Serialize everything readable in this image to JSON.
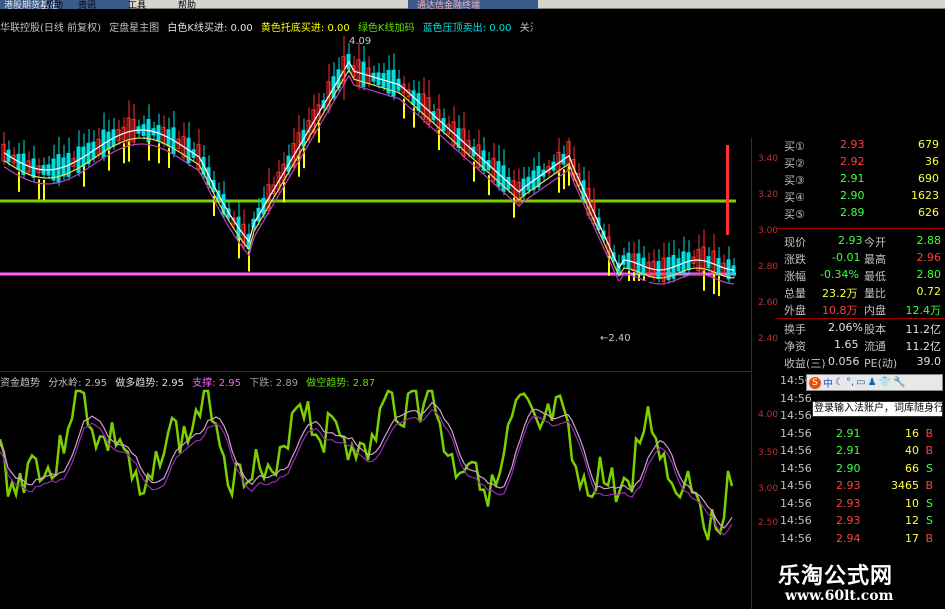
{
  "menu": {
    "tab_left": "港股期货基金",
    "items": [
      "帮助",
      "资讯",
      "工具",
      "帮助"
    ],
    "tab_right": "通达信金融终端"
  },
  "main_chart": {
    "stock_name": "华联控股(日线 前复权)",
    "indicator": "定盘星主图",
    "white_k": "白色K线买进: 0.00",
    "yellow": "黄色托底买进: 0.00",
    "green": "绿色K线加码",
    "cyan": "蓝色压顶卖出: 0.00",
    "attention": "关注信",
    "high_label": "4.09",
    "low_label": "←2.40",
    "y_ticks": [
      "3.40",
      "3.20",
      "3.00",
      "2.80",
      "2.60",
      "2.40"
    ]
  },
  "sub_chart": {
    "name": "资金趋势",
    "water": "分水岭: 2.95",
    "long": "做多趋势: 2.95",
    "support": "支撑: 2.95",
    "down": "下跌: 2.89",
    "short": "做空趋势: 2.87",
    "y_ticks": [
      "4.00",
      "3.50",
      "3.00",
      "2.50"
    ]
  },
  "colors": {
    "green_line": "#7cd000",
    "magenta_line": "#ff60ff",
    "up": "#ff3030",
    "down": "#00e0e0",
    "yellow": "#ffff00"
  },
  "quote": {
    "buy": [
      {
        "label": "买①",
        "price": "2.93",
        "vol": "679"
      },
      {
        "label": "买②",
        "price": "2.92",
        "vol": "36"
      },
      {
        "label": "买③",
        "price": "2.91",
        "vol": "690"
      },
      {
        "label": "买④",
        "price": "2.90",
        "vol": "1623"
      },
      {
        "label": "买⑤",
        "price": "2.89",
        "vol": "626"
      }
    ],
    "stats": [
      {
        "l1": "现价",
        "v1": "2.93",
        "l2": "今开",
        "v2": "2.88"
      },
      {
        "l1": "涨跌",
        "v1": "-0.01",
        "l2": "最高",
        "v2": "2.96"
      },
      {
        "l1": "涨幅",
        "v1": "-0.34%",
        "l2": "最低",
        "v2": "2.80"
      },
      {
        "l1": "总量",
        "v1": "23.2万",
        "l2": "量比",
        "v2": "0.72"
      },
      {
        "l1": "外盘",
        "v1": "10.8万",
        "l2": "内盘",
        "v2": "12.4万"
      }
    ],
    "stats2": [
      {
        "l1": "换手",
        "v1": "2.06%",
        "l2": "股本",
        "v2": "11.2亿"
      },
      {
        "l1": "净资",
        "v1": "1.65",
        "l2": "流通",
        "v2": "11.2亿"
      },
      {
        "l1": "收益(三)",
        "v1": "0.056",
        "l2": "PE(动)",
        "v2": "39.0"
      }
    ],
    "ticks": [
      {
        "t": "14:56",
        "p": "",
        "v": "",
        "d": ""
      },
      {
        "t": "14:56",
        "p": "",
        "v": "",
        "d": ""
      },
      {
        "t": "14:56",
        "p": "",
        "v": "",
        "d": ""
      },
      {
        "t": "14:56",
        "p": "2.91",
        "v": "16",
        "d": "B"
      },
      {
        "t": "14:56",
        "p": "2.91",
        "v": "40",
        "d": "B"
      },
      {
        "t": "14:56",
        "p": "2.90",
        "v": "66",
        "d": "S"
      },
      {
        "t": "14:56",
        "p": "2.93",
        "v": "3465",
        "d": "B"
      },
      {
        "t": "14:56",
        "p": "2.93",
        "v": "10",
        "d": "S"
      },
      {
        "t": "14:56",
        "p": "2.93",
        "v": "12",
        "d": "S"
      },
      {
        "t": "14:56",
        "p": "2.94",
        "v": "17",
        "d": "B"
      },
      {
        "t": "14:56",
        "p": "2.93",
        "v": "",
        "d": ""
      }
    ]
  },
  "ime": {
    "mode": "中",
    "tooltip": "登录输入法账户，词库随身行"
  },
  "watermark": {
    "title": "乐淘公式网",
    "url": "www.60lt.com"
  }
}
